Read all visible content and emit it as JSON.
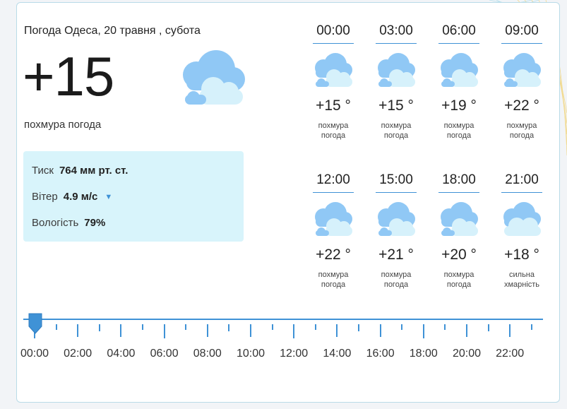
{
  "widget": {
    "title": "Погода Одеса, 20 травня , субота",
    "current_temp": "+15",
    "condition": "похмура погода",
    "icon": "cloudy-icon"
  },
  "details": {
    "pressure_label": "Тиск",
    "pressure_value": "764 мм рт. ст.",
    "wind_label": "Вітер",
    "wind_value": "4.9 м/с",
    "wind_icon": "wind-direction-arrow-icon",
    "humidity_label": "Вологість",
    "humidity_value": "79%"
  },
  "hourly": [
    {
      "time": "00:00",
      "temp": "+15 °",
      "desc1": "похмура",
      "desc2": "погода",
      "icon": "cloudy-icon"
    },
    {
      "time": "03:00",
      "temp": "+15 °",
      "desc1": "похмура",
      "desc2": "погода",
      "icon": "cloudy-icon"
    },
    {
      "time": "06:00",
      "temp": "+19 °",
      "desc1": "похмура",
      "desc2": "погода",
      "icon": "cloudy-icon"
    },
    {
      "time": "09:00",
      "temp": "+22 °",
      "desc1": "похмура",
      "desc2": "погода",
      "icon": "cloudy-icon"
    },
    {
      "time": "12:00",
      "temp": "+22 °",
      "desc1": "похмура",
      "desc2": "погода",
      "icon": "cloudy-icon"
    },
    {
      "time": "15:00",
      "temp": "+21 °",
      "desc1": "похмура",
      "desc2": "погода",
      "icon": "cloudy-icon"
    },
    {
      "time": "18:00",
      "temp": "+20 °",
      "desc1": "похмура",
      "desc2": "погода",
      "icon": "cloudy-icon"
    },
    {
      "time": "21:00",
      "temp": "+18 °",
      "desc1": "сильна",
      "desc2": "хмарність",
      "icon": "overcast-icon"
    }
  ],
  "timeline": {
    "labels": [
      "00:00",
      "02:00",
      "04:00",
      "06:00",
      "08:00",
      "10:00",
      "12:00",
      "14:00",
      "16:00",
      "18:00",
      "20:00",
      "22:00"
    ],
    "selected": "00:00"
  },
  "colors": {
    "accent": "#3f92d6",
    "details_bg": "#d8f4fb",
    "cloud_dark": "#90c8f5",
    "cloud_light": "#d6f1fb"
  }
}
